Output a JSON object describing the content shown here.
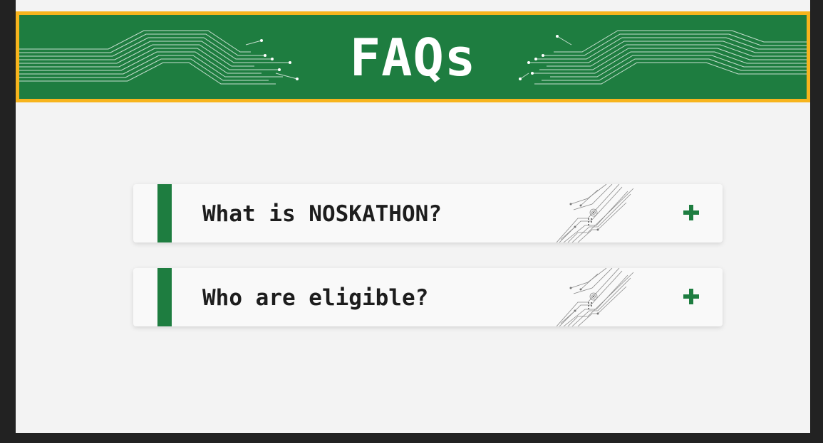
{
  "header": {
    "title": "FAQs"
  },
  "faqs": [
    {
      "question": "What is NOSKATHON?",
      "toggle": "+"
    },
    {
      "question": "Who are eligible?",
      "toggle": "+"
    }
  ],
  "colors": {
    "background": "#222222",
    "page": "#f3f3f3",
    "banner_green": "#1e7d40",
    "banner_border": "#f7b41d",
    "accent": "#1e7d40",
    "question_text": "#1d1d1d"
  },
  "icons": {
    "banner_decoration": "circuit-lines-icon",
    "card_decoration": "circuit-icon",
    "expand": "plus-icon"
  }
}
